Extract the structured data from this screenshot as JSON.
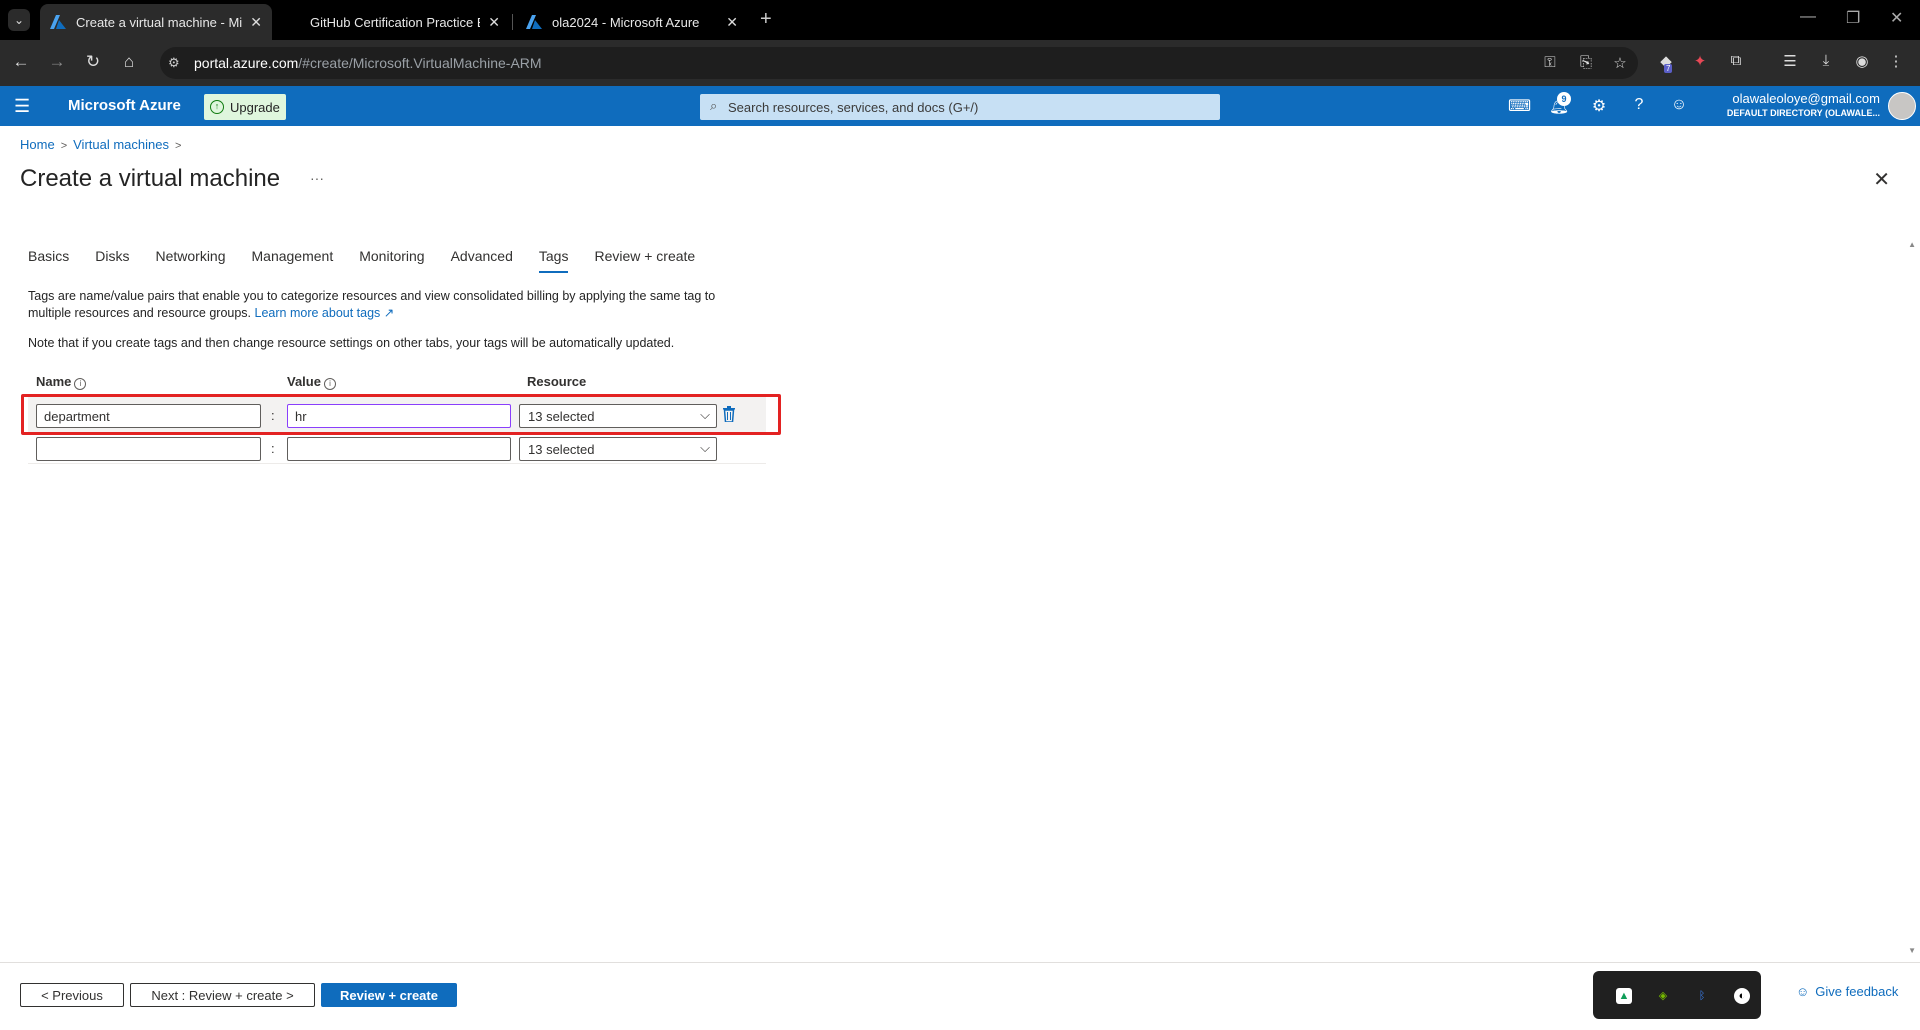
{
  "browser": {
    "tabs": [
      {
        "title": "Create a virtual machine - Micro",
        "active": true
      },
      {
        "title": "GitHub Certification Practice Ex",
        "active": false
      },
      {
        "title": "ola2024 - Microsoft Azure",
        "active": false
      }
    ],
    "url_host": "portal.azure.com",
    "url_path": "/#create/Microsoft.VirtualMachine-ARM",
    "extension_badge": "7"
  },
  "header": {
    "brand": "Microsoft Azure",
    "upgrade_label": "Upgrade",
    "search_placeholder": "Search resources, services, and docs (G+/)",
    "notification_count": "9",
    "user_email": "olawaleoloye@gmail.com",
    "user_directory": "DEFAULT DIRECTORY (OLAWALE..."
  },
  "breadcrumb": {
    "home": "Home",
    "section": "Virtual machines"
  },
  "page": {
    "title": "Create a virtual machine",
    "more": "···"
  },
  "tabs": [
    "Basics",
    "Disks",
    "Networking",
    "Management",
    "Monitoring",
    "Advanced",
    "Tags",
    "Review + create"
  ],
  "selected_tab": "Tags",
  "description": {
    "text": "Tags are name/value pairs that enable you to categorize resources and view consolidated billing by applying the same tag to multiple resources and resource groups.",
    "link": "Learn more about tags",
    "note": "Note that if you create tags and then change resource settings on other tabs, your tags will be automatically updated."
  },
  "columns": {
    "name": "Name",
    "value": "Value",
    "resource": "Resource"
  },
  "tag_rows": [
    {
      "name": "department",
      "value": "hr",
      "resource": "13 selected"
    },
    {
      "name": "",
      "value": "",
      "resource": "13 selected"
    }
  ],
  "footer": {
    "previous": "< Previous",
    "next": "Next : Review + create >",
    "review": "Review + create",
    "feedback": "Give feedback"
  },
  "colors": {
    "accent": "#0f6cbd",
    "highlight_box": "#e32222"
  }
}
